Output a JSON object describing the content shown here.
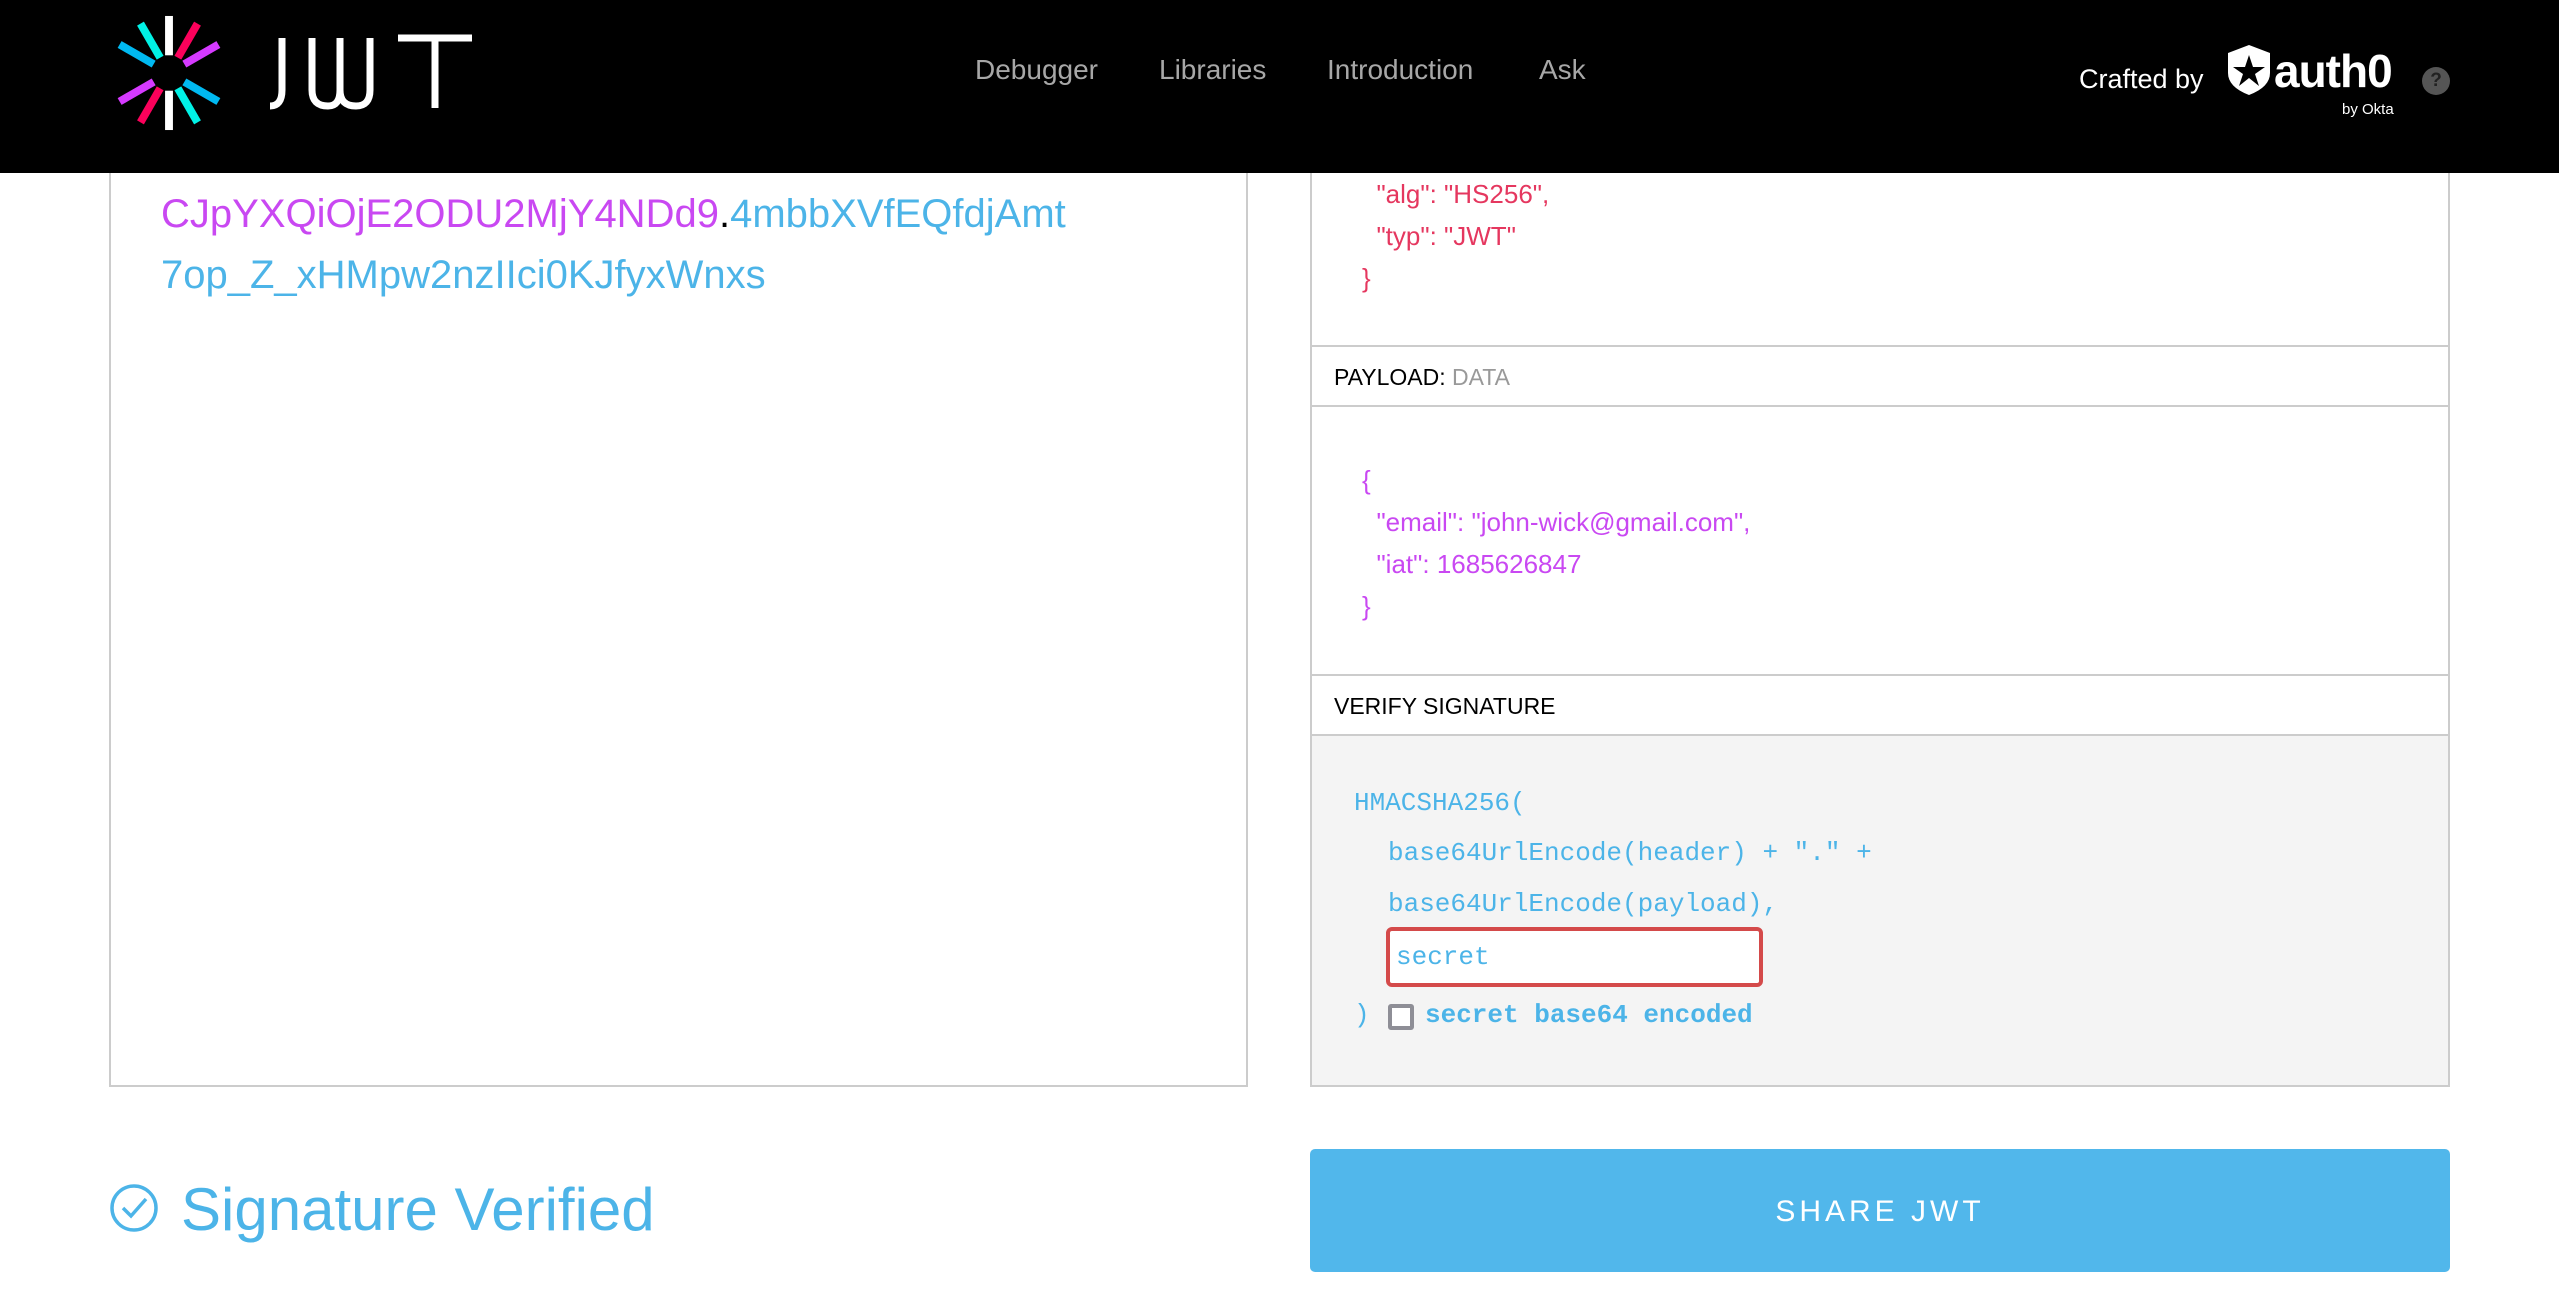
{
  "header": {
    "logo_text": "JWT",
    "nav": [
      "Debugger",
      "Libraries",
      "Introduction",
      "Ask"
    ],
    "crafted_by": "Crafted by",
    "brand": "auth0",
    "brand_sub": "by Okta",
    "help": "?"
  },
  "encoded": {
    "line1_payload": "CJpYXQiOjE2ODU2MjY4NDd9",
    "dot": ".",
    "line1_signature": "4mbbXVfEQfdjAmt",
    "line2_signature": "7op_Z_xHMpw2nzIIci0KJfyxWnxs"
  },
  "decoded": {
    "header_lines": [
      "  \"alg\": \"HS256\",",
      "  \"typ\": \"JWT\"",
      "}"
    ],
    "payload_label": "PAYLOAD:",
    "payload_sub": "DATA",
    "payload_lines": [
      "{",
      "  \"email\": \"john-wick@gmail.com\",",
      "  \"iat\": 1685626847",
      "}"
    ],
    "verify_label": "VERIFY SIGNATURE",
    "sig_fn": "HMACSHA256(",
    "sig_line1": "base64UrlEncode(header) + \".\" +",
    "sig_line2": "base64UrlEncode(payload),",
    "secret_value": "secret",
    "close_paren": ")",
    "b64_label": "secret base64 encoded",
    "b64_checked": false
  },
  "status": {
    "verified": "Signature Verified"
  },
  "share_label": "SHARE JWT",
  "colors": {
    "header_json": "#e5375f",
    "payload_json": "#c948f2",
    "signature": "#4cb4e8",
    "share_button": "#51b7eb"
  }
}
